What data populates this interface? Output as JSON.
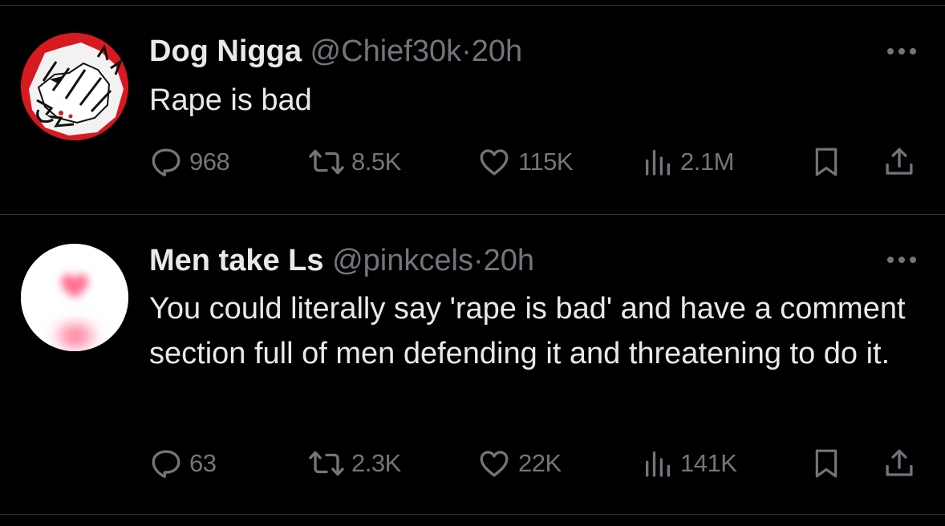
{
  "colors": {
    "background": "#000000",
    "text_primary": "#e7e9ea",
    "text_secondary": "#71767b",
    "divider": "#2f3336",
    "avatar_1_ring": "#d71920",
    "avatar_2_heart": "#ff6f91"
  },
  "tweets": [
    {
      "display_name": "Dog Nigga",
      "handle": "@Chief30k",
      "separator": "·",
      "time": "20h",
      "text": "Rape is bad",
      "avatar_icon": "wolf-avatar-icon",
      "counts": {
        "reply": "968",
        "retweet": "8.5K",
        "like": "115K",
        "views": "2.1M"
      }
    },
    {
      "display_name": "Men take Ls",
      "handle": "@pinkcels",
      "separator": "·",
      "time": "20h",
      "text": "You could literally say 'rape is bad' and have a comment section full of men defending it and threatening to do it.",
      "avatar_icon": "pink-heart-avatar-icon",
      "counts": {
        "reply": "63",
        "retweet": "2.3K",
        "like": "22K",
        "views": "141K"
      }
    }
  ],
  "icons": {
    "reply": "reply-icon",
    "retweet": "retweet-icon",
    "like": "heart-icon",
    "views": "views-icon",
    "bookmark": "bookmark-icon",
    "share": "share-icon",
    "more": "more-icon"
  }
}
